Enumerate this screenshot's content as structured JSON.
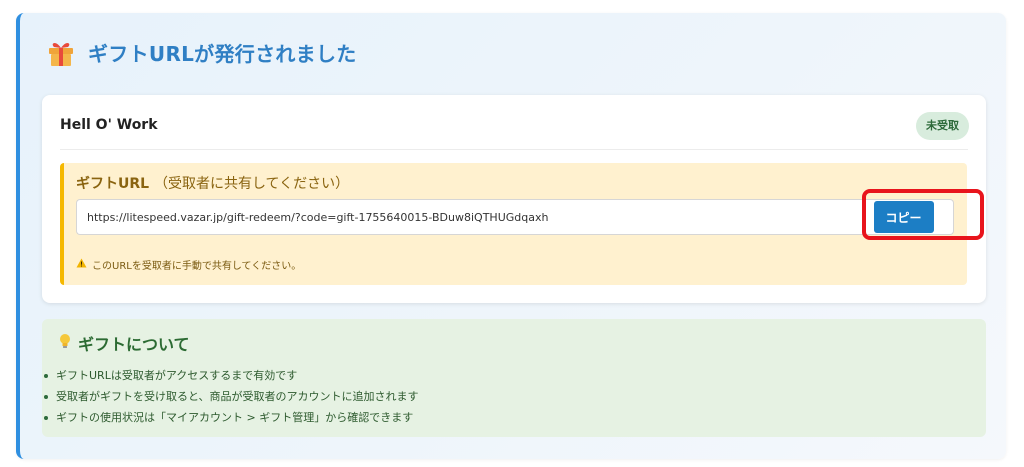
{
  "header": {
    "title": "ギフトURLが発行されました",
    "icon": "gift-icon"
  },
  "gift": {
    "product_name": "Hell O' Work",
    "status": "未受取",
    "url_label": "ギフトURL",
    "url_label_note": "（受取者に共有してください）",
    "url_value": "https://litespeed.vazar.jp/gift-redeem/?code=gift-1755640015-BDuw8iQTHUGdqaxh",
    "copy_label": "コピー",
    "warning": "このURLを受取者に手動で共有してください。"
  },
  "info": {
    "title": "ギフトについて",
    "icon": "lightbulb-icon",
    "items": [
      "ギフトURLは受取者がアクセスするまで有効です",
      "受取者がギフトを受け取ると、商品が受取者のアカウントに追加されます",
      "ギフトの使用状況は「マイアカウント > ギフト管理」から確認できます"
    ]
  },
  "colors": {
    "accent": "#2f8fe0",
    "title": "#2f7fc4",
    "copy_button": "#1c7ec5",
    "highlight": "#e8141c",
    "url_box": "#fff1cf",
    "info_box": "#e6f2e3"
  }
}
